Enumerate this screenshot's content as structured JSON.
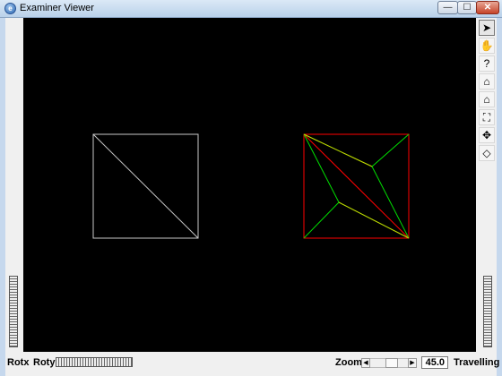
{
  "window": {
    "title": "Examiner Viewer",
    "icon_glyph": "e",
    "controls": {
      "minimize": "—",
      "maximize": "☐",
      "close": "✕"
    }
  },
  "toolbar": {
    "tools": [
      {
        "name": "select-arrow-icon",
        "glyph": "➤",
        "active": true
      },
      {
        "name": "hand-icon",
        "glyph": "✋",
        "active": false
      },
      {
        "name": "help-icon",
        "glyph": "?",
        "active": false
      },
      {
        "name": "home-icon",
        "glyph": "⌂",
        "active": false
      },
      {
        "name": "set-home-icon",
        "glyph": "⌂",
        "active": false
      },
      {
        "name": "view-all-icon",
        "glyph": "⛶",
        "active": false
      },
      {
        "name": "seek-icon",
        "glyph": "✥",
        "active": false
      },
      {
        "name": "perspective-icon",
        "glyph": "◇",
        "active": false
      }
    ]
  },
  "bottom_bar": {
    "rotx_label": "Rotx",
    "roty_label": "Roty",
    "zoom_label": "Zoom",
    "zoom_value": "45.0",
    "mode_label": "Travelling",
    "zoom_slider_position": 0.6
  },
  "scene": {
    "background": "#000000",
    "left_shape_color": "#c8c8c8",
    "right_outline_color": "#ff0000",
    "right_inner_colors": [
      "#ff0000",
      "#00ff00",
      "#cccc00"
    ]
  }
}
